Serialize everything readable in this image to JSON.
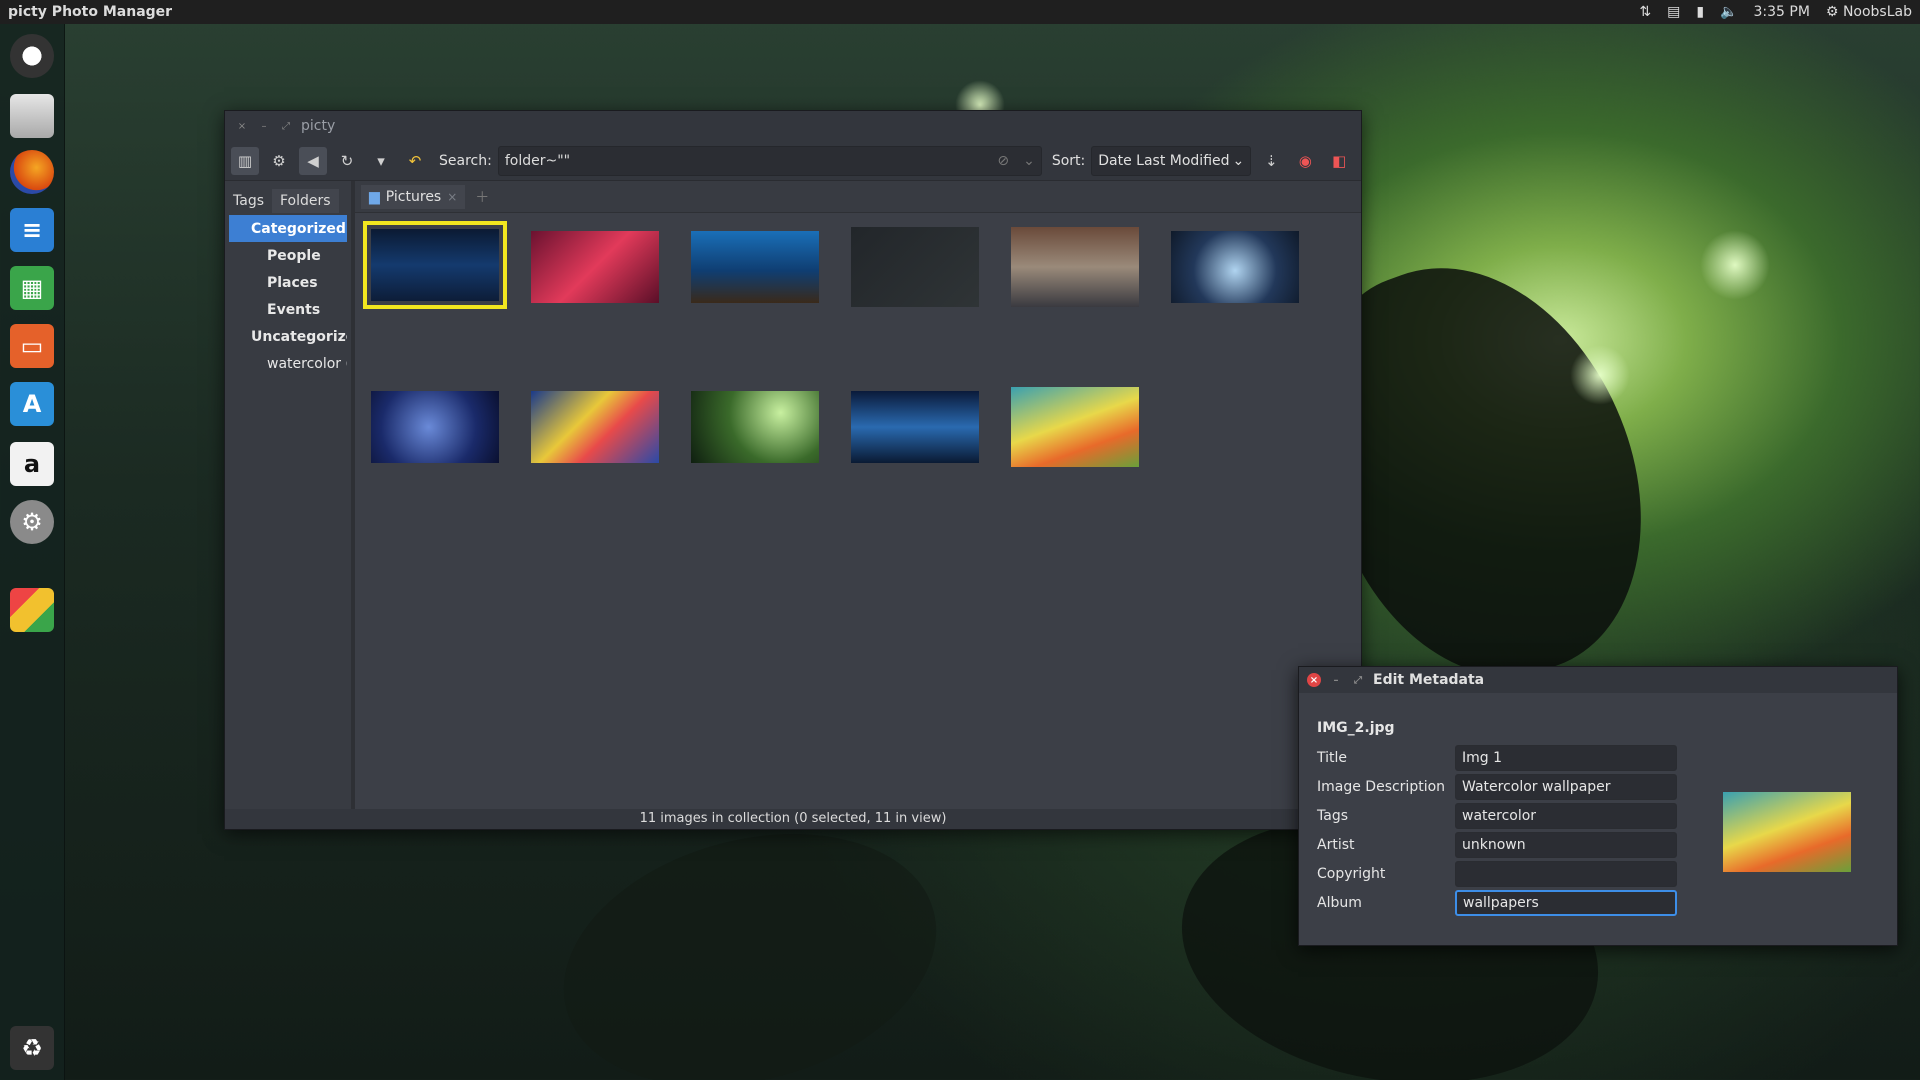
{
  "desktop": {
    "top_title": "picty Photo Manager",
    "clock": "3:35 PM",
    "user": "NoobsLab",
    "tray_icons": [
      "network-icon",
      "keyboard-icon",
      "battery-icon",
      "volume-icon",
      "gear-icon"
    ]
  },
  "launcher": {
    "items": [
      "dash-icon",
      "files-icon",
      "firefox-icon",
      "writer-icon",
      "calc-icon",
      "impress-icon",
      "software-center-icon",
      "amazon-icon",
      "settings-icon",
      "picty-icon",
      "trash-icon"
    ]
  },
  "main_window": {
    "title": "picty",
    "search_label": "Search:",
    "search_value": "folder~\"\"",
    "sort_label": "Sort:",
    "sort_value": "Date Last Modified",
    "side_tabs": [
      "Tags",
      "Folders"
    ],
    "tree": [
      {
        "label": "Categorized",
        "level": 0,
        "selected": true
      },
      {
        "label": "People",
        "level": 1
      },
      {
        "label": "Places",
        "level": 1
      },
      {
        "label": "Events",
        "level": 1
      },
      {
        "label": "Uncategorize",
        "level": 0
      },
      {
        "label": "watercolor (",
        "level": 1
      }
    ],
    "content_tab": "Pictures",
    "status": "11 images in collection (0 selected, 11 in view)",
    "thumbnails": [
      {
        "name": "night-city",
        "selected": true
      },
      {
        "name": "red-forest"
      },
      {
        "name": "bokeh-lights"
      },
      {
        "name": "triangles"
      },
      {
        "name": "street"
      },
      {
        "name": "glowing-tree"
      },
      {
        "name": "blue-panda"
      },
      {
        "name": "rainbow-swirl"
      },
      {
        "name": "green-cat"
      },
      {
        "name": "mountain-lake"
      },
      {
        "name": "watercolor"
      }
    ]
  },
  "metadata_dialog": {
    "title": "Edit Metadata",
    "filename": "IMG_2.jpg",
    "fields": [
      {
        "label": "Title",
        "value": "Img 1"
      },
      {
        "label": "Image Description",
        "value": "Watercolor wallpaper"
      },
      {
        "label": "Tags",
        "value": "watercolor"
      },
      {
        "label": "Artist",
        "value": "unknown"
      },
      {
        "label": "Copyright",
        "value": ""
      },
      {
        "label": "Album",
        "value": "wallpapers"
      }
    ]
  }
}
